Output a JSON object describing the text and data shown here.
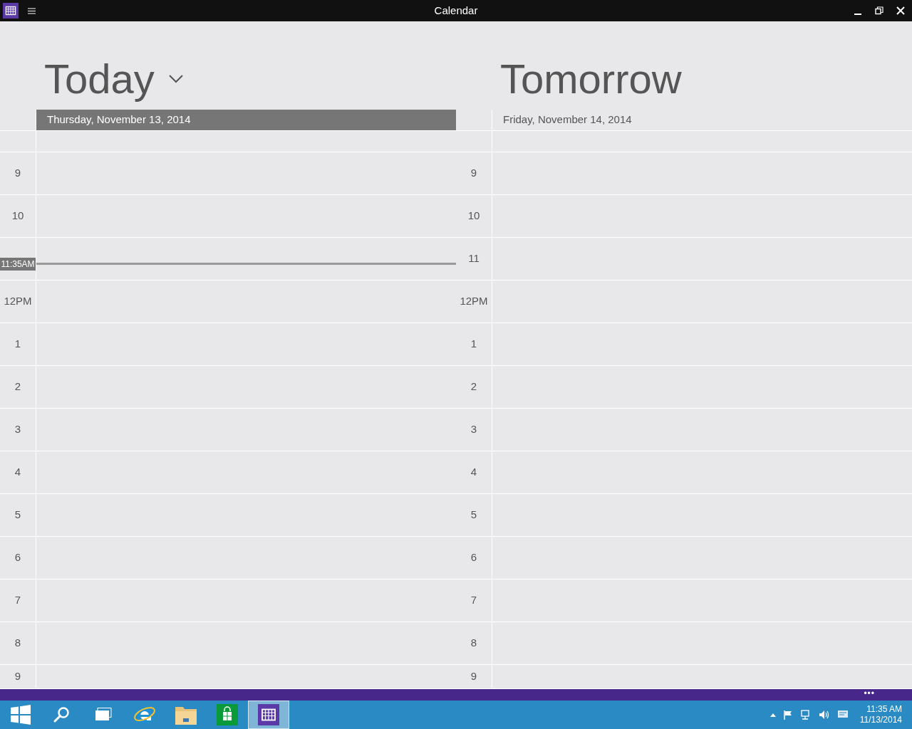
{
  "window": {
    "title": "Calendar"
  },
  "days": [
    {
      "heading": "Today",
      "dropdown": true,
      "date": "Thursday, November 13, 2014",
      "selected": true,
      "hours": [
        {
          "label": "9"
        },
        {
          "label": "10"
        },
        {
          "label": "11:35AM",
          "kind": "now"
        },
        {
          "label": "12PM"
        },
        {
          "label": "1"
        },
        {
          "label": "2"
        },
        {
          "label": "3"
        },
        {
          "label": "4"
        },
        {
          "label": "5"
        },
        {
          "label": "6"
        },
        {
          "label": "7"
        },
        {
          "label": "8"
        },
        {
          "label": "9"
        }
      ]
    },
    {
      "heading": "Tomorrow",
      "dropdown": false,
      "date": "Friday, November 14, 2014",
      "selected": false,
      "hours": [
        {
          "label": "9"
        },
        {
          "label": "10"
        },
        {
          "label": "11"
        },
        {
          "label": "12PM"
        },
        {
          "label": "1"
        },
        {
          "label": "2"
        },
        {
          "label": "3"
        },
        {
          "label": "4"
        },
        {
          "label": "5"
        },
        {
          "label": "6"
        },
        {
          "label": "7"
        },
        {
          "label": "8"
        },
        {
          "label": "9"
        }
      ]
    }
  ],
  "app_bar": {
    "more": "•••"
  },
  "taskbar": {
    "items": [
      {
        "kind": "start",
        "selected": false
      },
      {
        "kind": "search",
        "selected": false
      },
      {
        "kind": "taskview",
        "selected": false
      },
      {
        "kind": "browser",
        "selected": false
      },
      {
        "kind": "folder",
        "selected": false
      },
      {
        "kind": "store",
        "selected": false
      },
      {
        "kind": "calendar",
        "selected": true
      }
    ],
    "clock": {
      "time": "11:35 AM",
      "date": "11/13/2014"
    }
  }
}
